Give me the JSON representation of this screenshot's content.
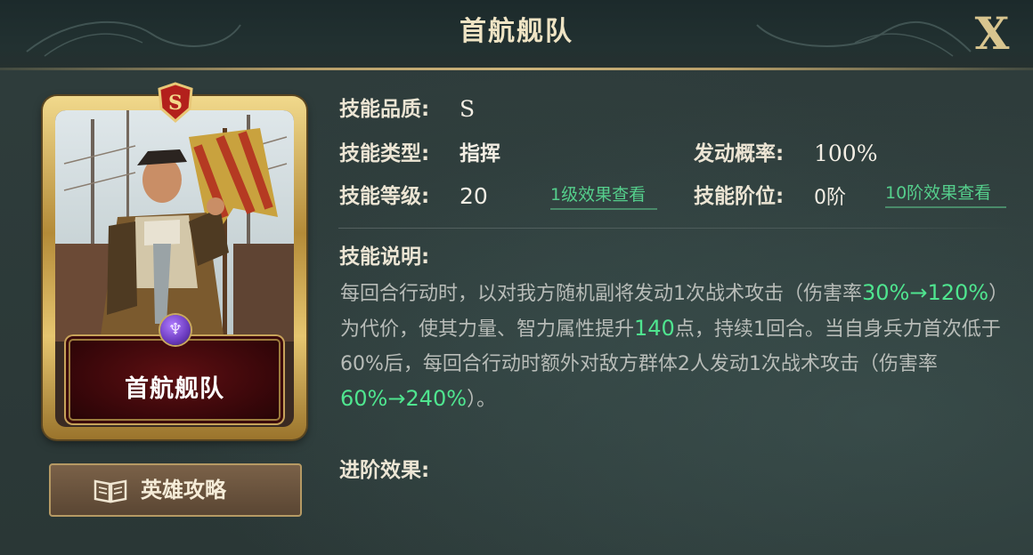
{
  "header": {
    "title": "首航舰队",
    "close_label": "X"
  },
  "card": {
    "name": "首航舰队",
    "grade": "S",
    "emblem_symbol": "♆"
  },
  "guide_button": {
    "label": "英雄攻略",
    "icon": "book-icon"
  },
  "skill": {
    "quality_label": "技能品质:",
    "quality_value": "S",
    "type_label": "技能类型:",
    "type_value": "指挥",
    "level_label": "技能等级:",
    "level_value": "20",
    "level_link": "1级效果查看",
    "rate_label": "发动概率:",
    "rate_value": "100%",
    "tier_label": "技能阶位:",
    "tier_value": "0阶",
    "tier_link": "10阶效果查看",
    "desc_label": "技能说明:",
    "desc": {
      "p1": "每回合行动时，以对我方随机副将发动1次战术攻击（伤害率",
      "h1": "30%→120%",
      "p2": "）为代价，使其力量、智力属性提升",
      "h2": "140",
      "p3": "点，持续1回合。当自身兵力首次低于60%后，每回合行动时额外对敌方群体2人发动1次战术攻击（伤害率",
      "h3": "60%→240%",
      "p4": "）。"
    },
    "advance_label": "进阶效果:"
  },
  "colors": {
    "highlight": "#4fe58f",
    "link": "#55cf8c",
    "gold": "#c9a95c",
    "card_name_bg": "#4a0a0d"
  }
}
